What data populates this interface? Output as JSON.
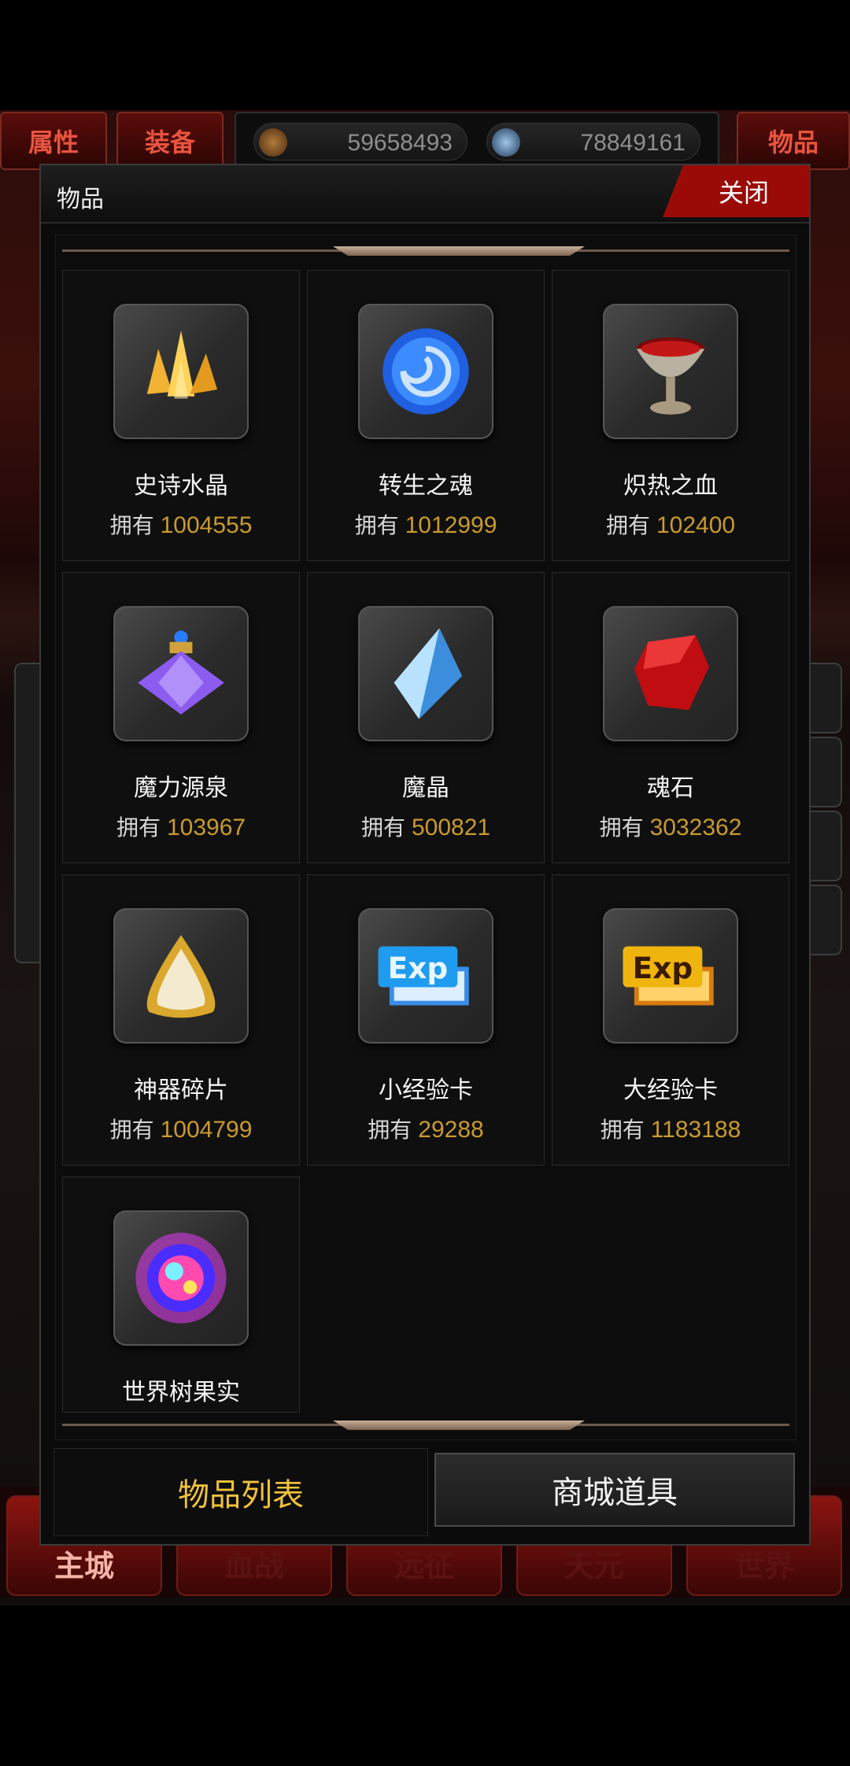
{
  "top_tabs": {
    "attributes": "属性",
    "equipment": "装备",
    "items": "物品"
  },
  "currency": {
    "gold": "59658493",
    "diamond": "78849161"
  },
  "bottom_nav": [
    "主城",
    "血战",
    "远征",
    "天元",
    "世界"
  ],
  "modal": {
    "title": "物品",
    "close_label": "关闭",
    "owned_prefix": "拥有",
    "items": [
      {
        "name": "史诗水晶",
        "count": "1004555",
        "icon": "gold-crystal-icon"
      },
      {
        "name": "转生之魂",
        "count": "1012999",
        "icon": "blue-soul-orb-icon"
      },
      {
        "name": "炽热之血",
        "count": "102400",
        "icon": "blood-chalice-icon"
      },
      {
        "name": "魔力源泉",
        "count": "103967",
        "icon": "purple-potion-icon"
      },
      {
        "name": "魔晶",
        "count": "500821",
        "icon": "ice-crystal-icon"
      },
      {
        "name": "魂石",
        "count": "3032362",
        "icon": "red-soul-stone-icon"
      },
      {
        "name": "神器碎片",
        "count": "1004799",
        "icon": "artifact-shard-icon"
      },
      {
        "name": "小经验卡",
        "count": "29288",
        "icon": "small-exp-card-icon"
      },
      {
        "name": "大经验卡",
        "count": "1183188",
        "icon": "large-exp-card-icon"
      },
      {
        "name": "世界树果实",
        "count": "",
        "icon": "world-tree-fruit-icon"
      }
    ],
    "tabs": {
      "item_list": "物品列表",
      "shop_items": "商城道具"
    }
  },
  "colors": {
    "accent_gold": "#c99a2e",
    "close_red": "#9a0b07",
    "tab_active": "#efc23a"
  }
}
